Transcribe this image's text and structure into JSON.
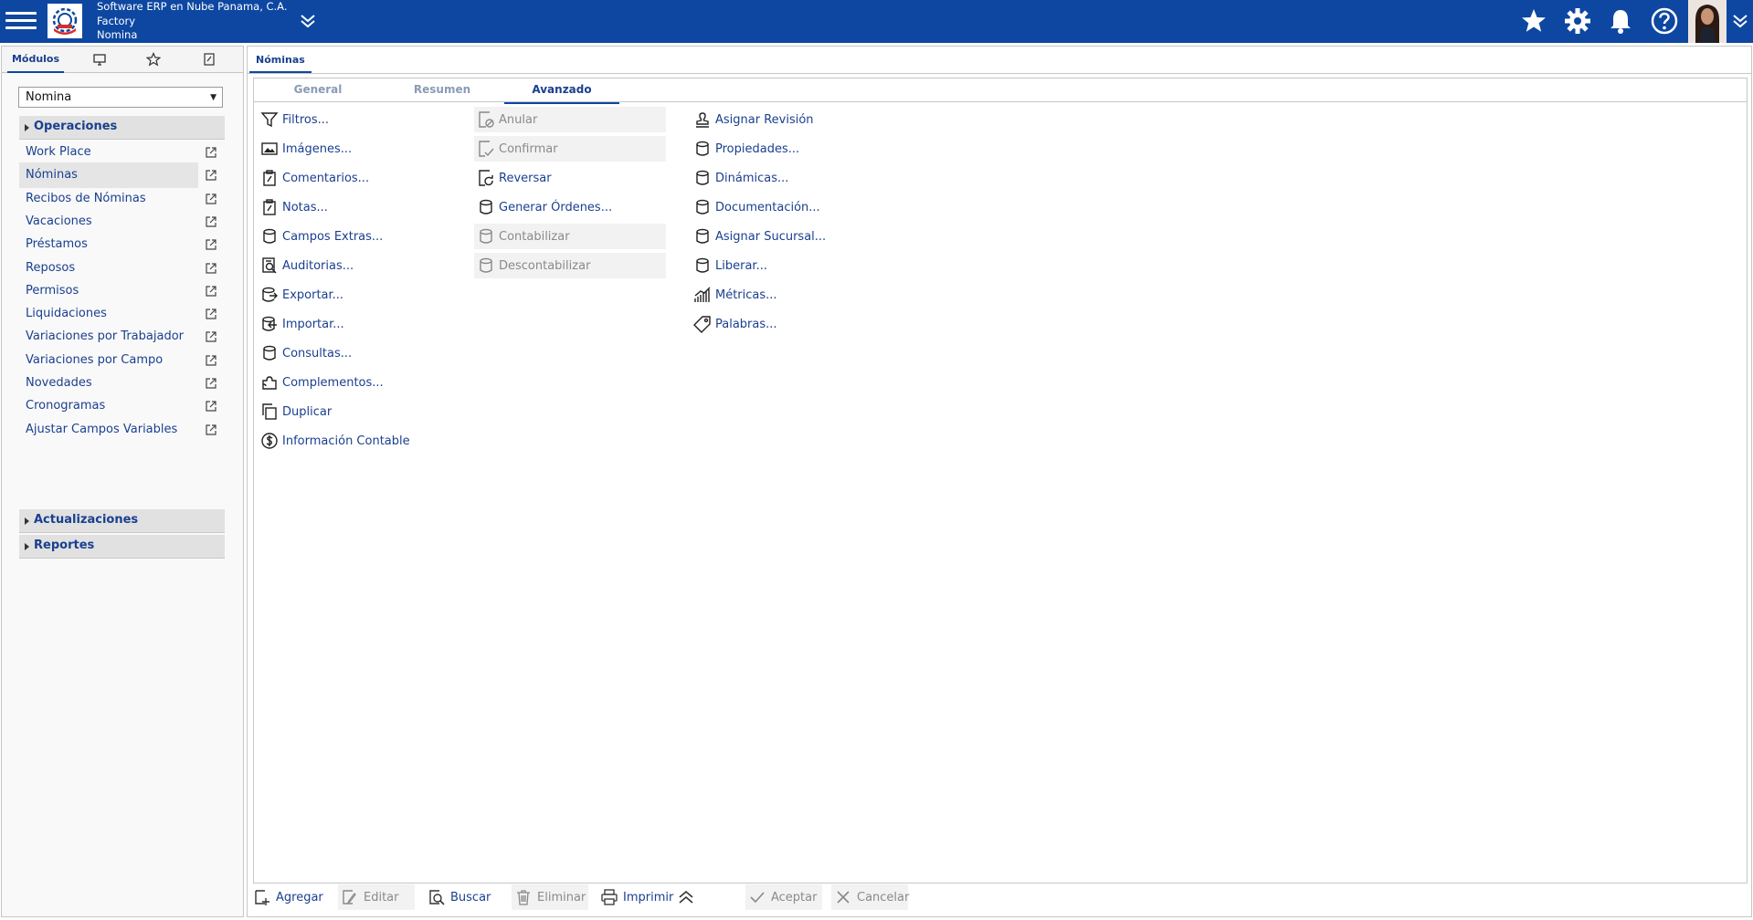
{
  "header": {
    "company": "Software ERP en Nube Panama, C.A.",
    "branch": "Factory",
    "module": "Nomina"
  },
  "sidebar": {
    "tabs": [
      {
        "label": "Módulos",
        "icon": "modules-tab"
      },
      {
        "label": "",
        "icon": "monitor-icon"
      },
      {
        "label": "",
        "icon": "star-icon"
      },
      {
        "label": "",
        "icon": "notes-icon"
      }
    ],
    "module_select": "Nomina",
    "sections": {
      "operaciones": "Operaciones",
      "actualizaciones": "Actualizaciones",
      "reportes": "Reportes"
    },
    "items": [
      "Work Place",
      "Nóminas",
      "Recibos de Nóminas",
      "Vacaciones",
      "Préstamos",
      "Reposos",
      "Permisos",
      "Liquidaciones",
      "Variaciones por Trabajador",
      "Variaciones por Campo",
      "Novedades",
      "Cronogramas",
      "Ajustar Campos Variables"
    ],
    "selected_item": "Nóminas"
  },
  "main": {
    "tab": "Nóminas",
    "subtabs": [
      "General",
      "Resumen",
      "Avanzado"
    ],
    "active_subtab": "Avanzado",
    "col1": [
      {
        "label": "Filtros...",
        "icon": "funnel-icon",
        "enabled": true
      },
      {
        "label": "Imágenes...",
        "icon": "image-icon",
        "enabled": true
      },
      {
        "label": "Comentarios...",
        "icon": "clipboard-icon",
        "enabled": true
      },
      {
        "label": "Notas...",
        "icon": "clipboard-icon",
        "enabled": true
      },
      {
        "label": "Campos Extras...",
        "icon": "database-icon",
        "enabled": true
      },
      {
        "label": "Auditorias...",
        "icon": "audit-icon",
        "enabled": true
      },
      {
        "label": "Exportar...",
        "icon": "export-icon",
        "enabled": true
      },
      {
        "label": "Importar...",
        "icon": "import-icon",
        "enabled": true
      },
      {
        "label": "Consultas...",
        "icon": "database-icon",
        "enabled": true
      },
      {
        "label": "Complementos...",
        "icon": "puzzle-icon",
        "enabled": true
      },
      {
        "label": "Duplicar",
        "icon": "duplicate-icon",
        "enabled": true
      },
      {
        "label": "Información Contable",
        "icon": "dollar-icon",
        "enabled": true
      }
    ],
    "col2": [
      {
        "label": "Anular",
        "icon": "void-icon",
        "enabled": false
      },
      {
        "label": "Confirmar",
        "icon": "confirm-icon",
        "enabled": false
      },
      {
        "label": "Reversar",
        "icon": "reverse-icon",
        "enabled": true
      },
      {
        "label": "Generar Órdenes...",
        "icon": "database-icon",
        "enabled": true
      },
      {
        "label": "Contabilizar",
        "icon": "database-icon",
        "enabled": false
      },
      {
        "label": "Descontabilizar",
        "icon": "database-icon",
        "enabled": false
      }
    ],
    "col3": [
      {
        "label": "Asignar Revisión",
        "icon": "stamp-icon",
        "enabled": true
      },
      {
        "label": "Propiedades...",
        "icon": "database-icon",
        "enabled": true
      },
      {
        "label": "Dinámicas...",
        "icon": "database-icon",
        "enabled": true
      },
      {
        "label": "Documentación...",
        "icon": "database-icon",
        "enabled": true
      },
      {
        "label": "Asignar Sucursal...",
        "icon": "database-icon",
        "enabled": true
      },
      {
        "label": "Liberar...",
        "icon": "database-icon",
        "enabled": true
      },
      {
        "label": "Métricas...",
        "icon": "metrics-icon",
        "enabled": true
      },
      {
        "label": "Palabras...",
        "icon": "tag-icon",
        "enabled": true
      }
    ]
  },
  "toolbar": {
    "add": "Agregar",
    "edit": "Editar",
    "search": "Buscar",
    "delete": "Eliminar",
    "print": "Imprimir",
    "accept": "Aceptar",
    "cancel": "Cancelar"
  },
  "colors": {
    "header_bg": "#0d47a1",
    "link": "#1a3f8f",
    "disabled": "#8a8a8a"
  }
}
